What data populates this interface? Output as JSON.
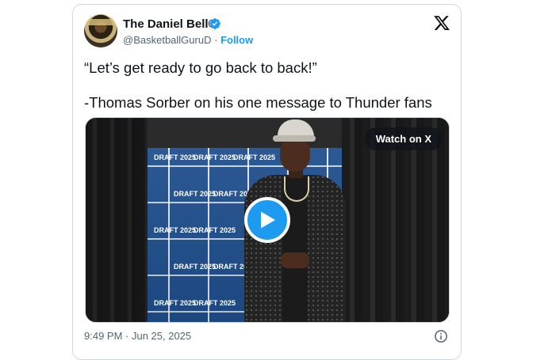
{
  "author": {
    "name": "The Daniel Bell©",
    "handle": "@BasketballGuruD",
    "separator": "·",
    "follow_label": "Follow",
    "verified": true
  },
  "tweet": {
    "line1": "“Let’s get ready to go back to back!”",
    "line2": "-Thomas Sorber on his one message to Thunder fans"
  },
  "media": {
    "watch_label": "Watch on X",
    "backdrop_text": "DRAFT 2025"
  },
  "footer": {
    "timestamp": "9:49 PM · Jun 25, 2025"
  },
  "colors": {
    "accent": "#1d9bf0",
    "text": "#0f1419",
    "secondary": "#536471"
  },
  "icons": [
    "verified-badge-icon",
    "x-logo-icon",
    "play-icon",
    "info-icon"
  ]
}
